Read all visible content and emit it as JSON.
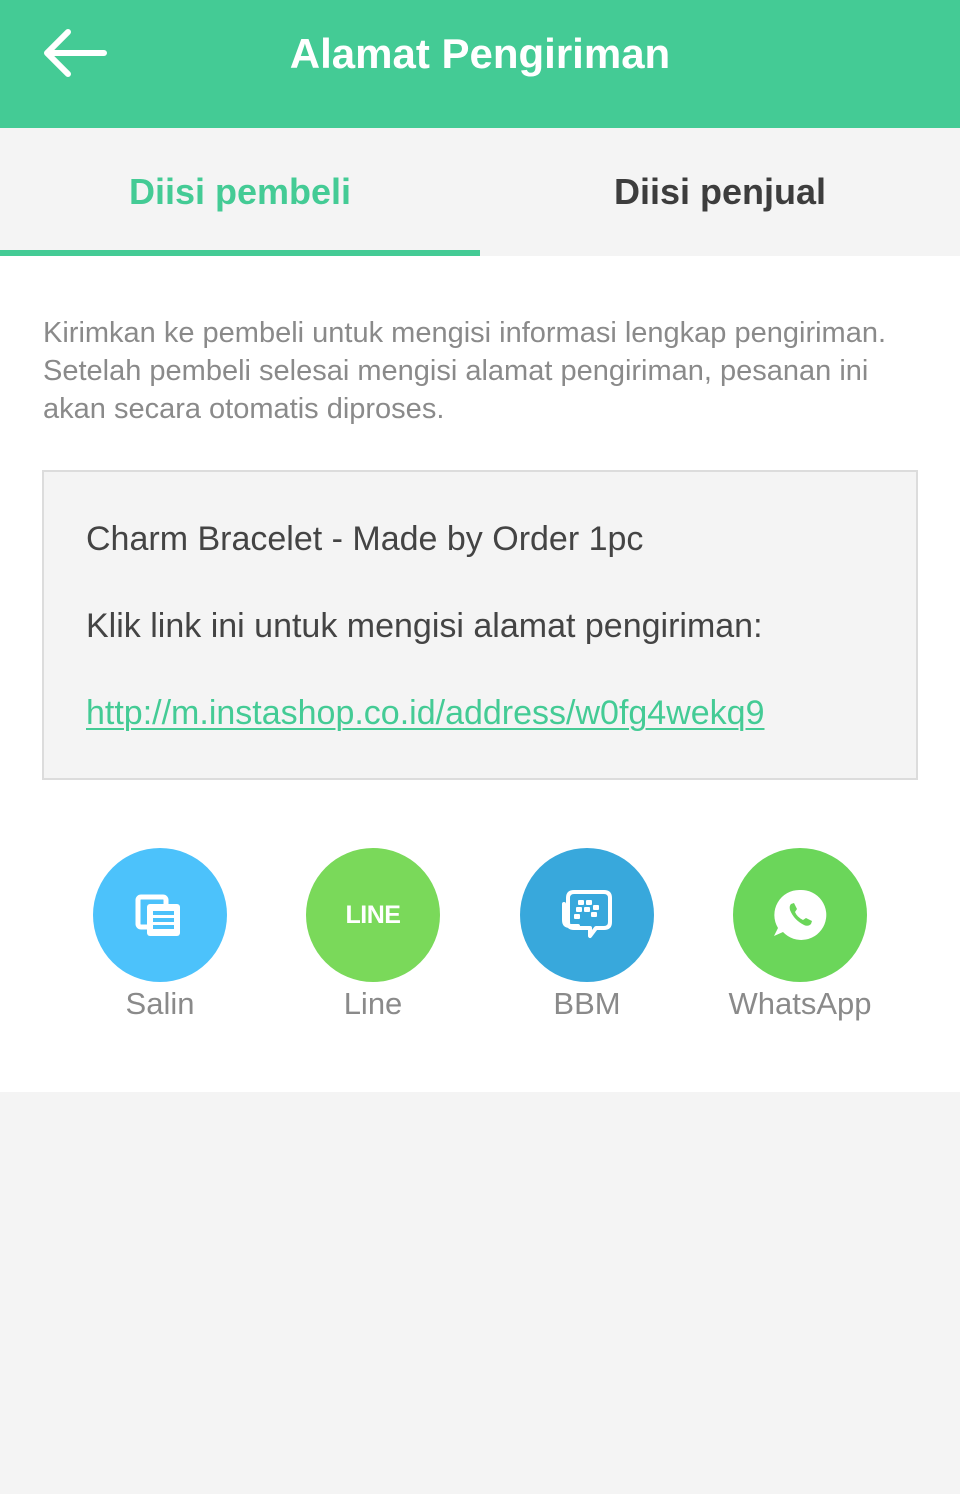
{
  "appbar": {
    "title": "Alamat Pengiriman",
    "back_icon": "arrow-left-icon",
    "color": "#44cb95"
  },
  "tabs": [
    {
      "label": "Diisi pembeli",
      "active": true
    },
    {
      "label": "Diisi penjual",
      "active": false
    }
  ],
  "description": "Kirimkan ke pembeli untuk mengisi informasi lengkap pengiriman. Setelah pembeli selesai mengisi alamat pengiriman, pesanan ini akan secara otomatis diproses.",
  "message": {
    "product": "Charm Bracelet - Made by Order 1pc",
    "instruction": "Klik link ini untuk mengisi alamat pengiriman:",
    "link": "http://m.instashop.co.id/address/w0fg4wekq9"
  },
  "share": [
    {
      "label": "Salin",
      "icon": "copy-icon",
      "color": "#4cc2fb"
    },
    {
      "label": "Line",
      "icon": "line-logo-icon",
      "icon_text": "LINE",
      "color": "#7ad95a"
    },
    {
      "label": "BBM",
      "icon": "bbm-icon",
      "color": "#38a8dc"
    },
    {
      "label": "WhatsApp",
      "icon": "whatsapp-icon",
      "color": "#6bd65a"
    }
  ]
}
